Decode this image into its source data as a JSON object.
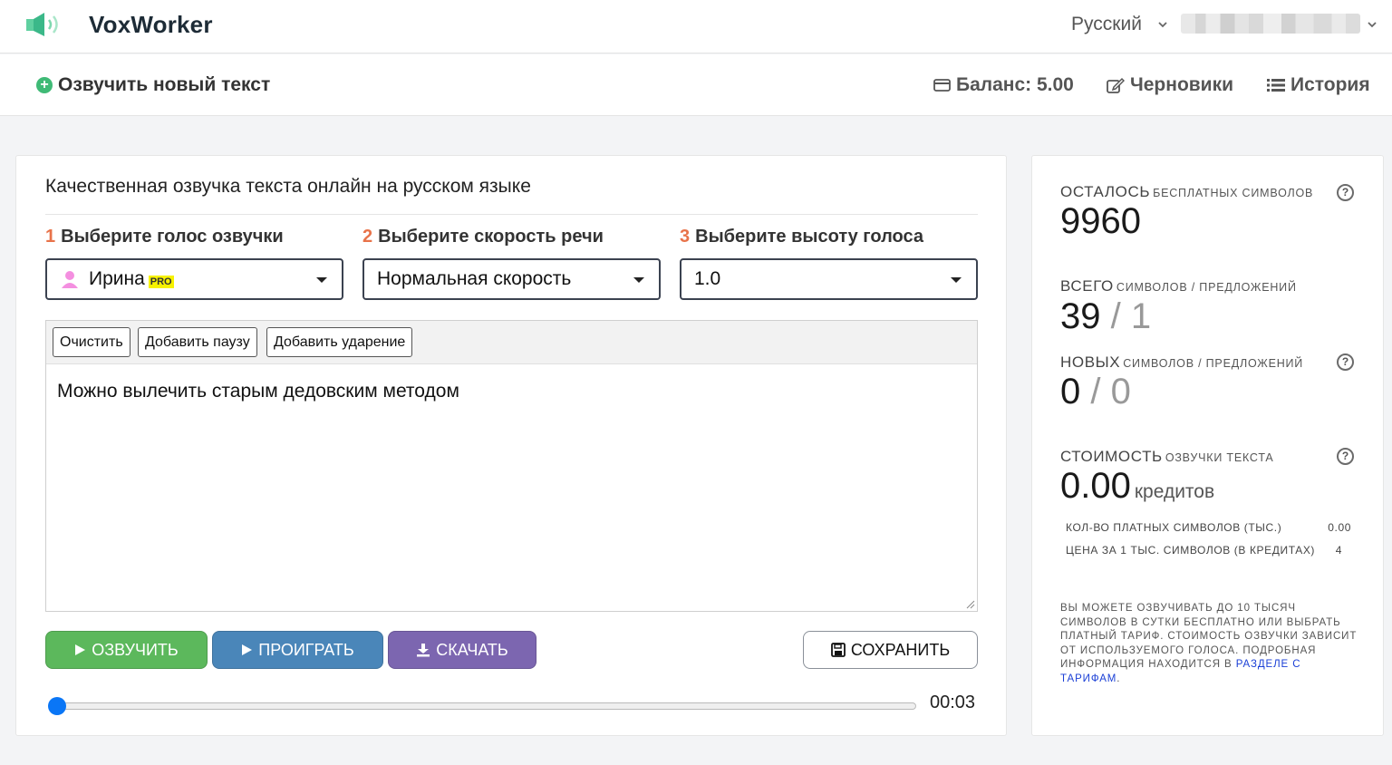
{
  "app": {
    "name": "VoxWorker"
  },
  "header": {
    "language": "Русский"
  },
  "subnav": {
    "new_text": "Озвучить новый текст",
    "balance": "Баланс: 5.00",
    "drafts": "Черновики",
    "history": "История"
  },
  "main": {
    "title": "Качественная озвучка текста онлайн на русском языке",
    "steps": [
      {
        "num": "1",
        "label": "Выберите голос озвучки",
        "value": "Ирина",
        "badge": "PRO"
      },
      {
        "num": "2",
        "label": "Выберите скорость речи",
        "value": "Нормальная скорость"
      },
      {
        "num": "3",
        "label": "Выберите высоту голоса",
        "value": "1.0"
      }
    ],
    "toolbar": {
      "clear": "Очистить",
      "add_pause": "Добавить паузу",
      "add_stress": "Добавить ударение"
    },
    "text": "Можно вылечить старым дедовским методом",
    "buttons": {
      "speak": "ОЗВУЧИТЬ",
      "play": "ПРОИГРАТЬ",
      "download": "СКАЧАТЬ",
      "save": "СОХРАНИТЬ"
    },
    "player": {
      "time": "00:03",
      "progress": 0.0
    }
  },
  "side": {
    "remaining": {
      "label": "ОСТАЛОСЬ",
      "sub": "бесплатных символов",
      "value": "9960"
    },
    "total": {
      "label": "ВСЕГО",
      "sub": "символов / предложений",
      "chars": "39",
      "sep": "/",
      "sentences": "1"
    },
    "new": {
      "label": "НОВЫХ",
      "sub": "символов / предложений",
      "chars": "0",
      "sep": "/",
      "sentences": "0"
    },
    "cost": {
      "label": "СТОИМОСТЬ",
      "sub": "озвучки текста",
      "value": "0.00",
      "unit": "кредитов"
    },
    "paid_chars": {
      "label": "КОЛ-ВО ПЛАТНЫХ СИМВОЛОВ (ТЫС.)",
      "value": "0.00"
    },
    "price": {
      "label": "ЦЕНА ЗА 1 ТЫС. СИМВОЛОВ (В КРЕДИТАХ)",
      "value": "4"
    },
    "note": "Вы можете озвучивать до 10 тысяч символов в сутки бесплатно или выбрать платный тариф. Стоимость озвучки зависит от используемого голоса. Подробная информация находится в",
    "note_link": "разделе с тарифам",
    "note_end": "."
  },
  "colors": {
    "accent_green": "#5cb85c",
    "accent_blue": "#4a86b9",
    "accent_purple": "#7c66b0",
    "step_number": "#e8734a"
  }
}
